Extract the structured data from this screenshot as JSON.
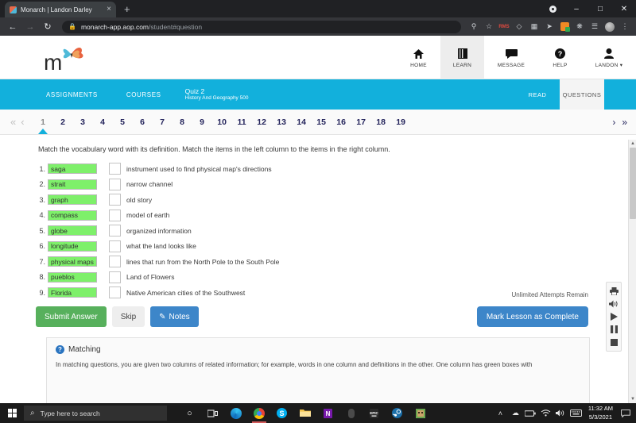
{
  "browser": {
    "tab_title": "Monarch | Landon Darley",
    "tab_close": "×",
    "new_tab": "+",
    "back": "←",
    "forward": "→",
    "reload": "↻",
    "lock_icon": "🔒",
    "url_domain": "monarch-app.aop.com",
    "url_path": "/student#question",
    "toolbar_icons": [
      "key-icon",
      "star-icon",
      "rms-extension",
      "pen-extension",
      "grid-extension",
      "cursor-extension",
      "orange-extension",
      "puzzle-extension",
      "readlist-extension",
      "profile-avatar",
      "menu-kebab"
    ],
    "red_ext_label": "RMS",
    "kebab": "⋮",
    "window": {
      "record": "●",
      "minimize": "–",
      "maximize": "□",
      "close": "✕"
    }
  },
  "header": {
    "logo_letter": "m",
    "nav": [
      {
        "label": "HOME",
        "icon": "home-icon",
        "active": false
      },
      {
        "label": "LEARN",
        "icon": "book-icon",
        "active": true
      },
      {
        "label": "MESSAGE",
        "icon": "message-icon",
        "active": false
      },
      {
        "label": "HELP",
        "icon": "help-icon",
        "active": false
      },
      {
        "label": "LANDON ▾",
        "icon": "person-icon",
        "active": false
      }
    ]
  },
  "bluebar": {
    "assignments": "ASSIGNMENTS",
    "courses": "COURSES",
    "quiz_title": "Quiz 2",
    "quiz_subtitle": "History And Geography 500",
    "read_tab": "READ",
    "questions_tab": "QUESTIONS",
    "accent": "#12b0dc"
  },
  "pager": {
    "first": "«",
    "prev": "‹",
    "next": "›",
    "last": "»",
    "pages": [
      "1",
      "2",
      "3",
      "4",
      "5",
      "6",
      "7",
      "8",
      "9",
      "10",
      "11",
      "12",
      "13",
      "14",
      "15",
      "16",
      "17",
      "18",
      "19"
    ],
    "current": "1"
  },
  "question": {
    "prompt": "Match the vocabulary word with its definition. Match the items in the left column to the items in the right column.",
    "items": [
      {
        "num": "1.",
        "word": "saga",
        "answer": "",
        "definition": "instrument used to find physical map's directions"
      },
      {
        "num": "2.",
        "word": "strait",
        "answer": "",
        "definition": "narrow channel"
      },
      {
        "num": "3.",
        "word": "graph",
        "answer": "",
        "definition": "old story"
      },
      {
        "num": "4.",
        "word": "compass",
        "answer": "",
        "definition": "model of earth"
      },
      {
        "num": "5.",
        "word": "globe",
        "answer": "",
        "definition": "organized information"
      },
      {
        "num": "6.",
        "word": "longitude",
        "answer": "",
        "definition": "what the land looks like"
      },
      {
        "num": "7.",
        "word": "physical maps",
        "answer": "",
        "definition": "lines that run from the North Pole to the South Pole"
      },
      {
        "num": "8.",
        "word": "pueblos",
        "answer": "",
        "definition": "Land of Flowers"
      },
      {
        "num": "9.",
        "word": "Florida",
        "answer": "",
        "definition": "Native American cities of the Southwest"
      }
    ],
    "word_box_color": "#7ef06a"
  },
  "actions": {
    "attempts": "Unlimited Attempts Remain",
    "submit": "Submit Answer",
    "skip": "Skip",
    "notes": "Notes",
    "notes_icon": "✎",
    "mark_complete": "Mark Lesson as Complete"
  },
  "help": {
    "badge": "?",
    "title": "Matching",
    "body": "In matching questions, you are given two columns of related information; for example, words in one column and definitions in the other. One column has green boxes with"
  },
  "mediabar": {
    "buttons": [
      {
        "name": "print-icon",
        "glyph": "⎙"
      },
      {
        "name": "volume-icon",
        "glyph": "🔊"
      },
      {
        "name": "play-icon",
        "glyph": "▶"
      },
      {
        "name": "pause-icon",
        "glyph": "‖"
      },
      {
        "name": "stop-icon",
        "glyph": "■"
      }
    ]
  },
  "scrollbar": {
    "up": "▲",
    "down": "▼"
  },
  "taskbar": {
    "search_placeholder": "Type here to search",
    "search_icon": "⌕",
    "cortana": "○",
    "taskview": "⌸",
    "apps": [
      "edge-icon",
      "chrome-icon",
      "skype-icon",
      "explorer-icon",
      "onenote-icon",
      "mouse-icon",
      "epic-games-icon",
      "steam-icon",
      "minecraft-icon"
    ],
    "tray": [
      "˄",
      "☁",
      "🖴",
      "📶",
      "🔊",
      "⌨"
    ],
    "time": "11:32 AM",
    "date": "5/3/2021",
    "notifications": "💬"
  }
}
